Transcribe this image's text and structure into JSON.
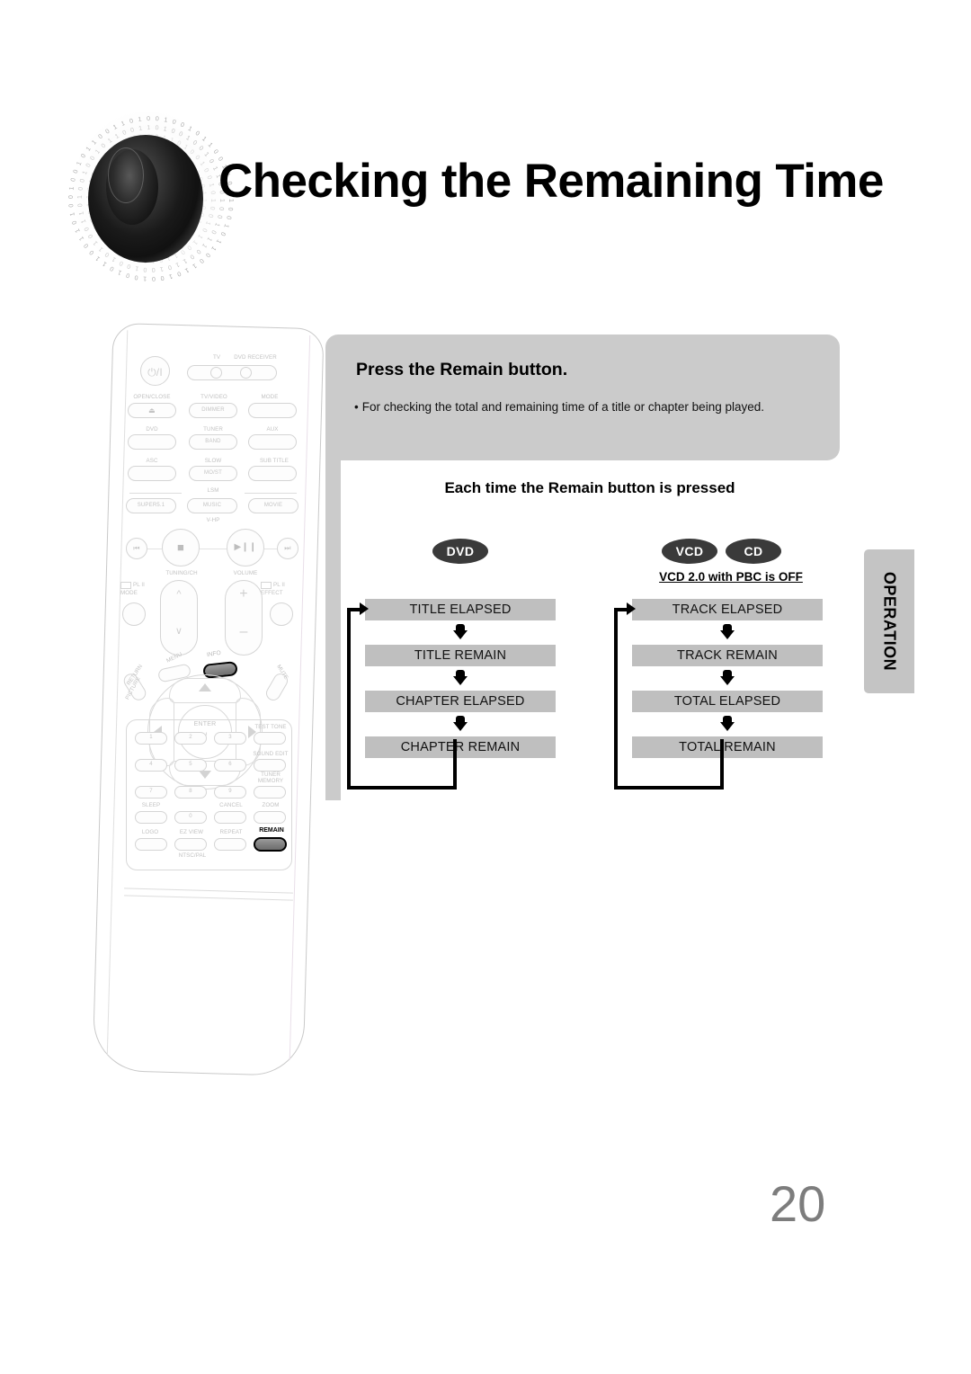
{
  "page": {
    "title": "Checking the Remaining Time",
    "number": "20",
    "side_tab": "OPERATION"
  },
  "callout": {
    "heading": "Press the Remain button.",
    "bullet_marker": "•",
    "bullet_text": "For checking the total and remaining time of a title or chapter being played."
  },
  "flow": {
    "heading": "Each time the Remain button is pressed",
    "note": "VCD 2.0 with PBC is OFF",
    "columns": [
      {
        "badges": [
          "DVD"
        ],
        "steps": [
          "TITLE ELAPSED",
          "TITLE REMAIN",
          "CHAPTER ELAPSED",
          "CHAPTER REMAIN"
        ]
      },
      {
        "badges": [
          "VCD",
          "CD"
        ],
        "steps": [
          "TRACK ELAPSED",
          "TRACK REMAIN",
          "TOTAL ELAPSED",
          "TOTAL REMAIN"
        ]
      }
    ]
  },
  "remote": {
    "power": "⏻/I",
    "selector": {
      "left": "TV",
      "right": "DVD RECEIVER"
    },
    "rows": [
      {
        "labels": [
          "OPEN/CLOSE",
          "TV/VIDEO",
          "MODE"
        ],
        "inner": [
          "⏏",
          "DIMMER",
          ""
        ]
      },
      {
        "labels": [
          "DVD",
          "TUNER",
          "AUX"
        ],
        "inner": [
          "",
          "BAND",
          ""
        ]
      },
      {
        "labels": [
          "ASC",
          "SLOW",
          "SUB TITLE"
        ],
        "inner": [
          "",
          "MO/ST",
          ""
        ]
      }
    ],
    "lsm_label": "LSM",
    "lsm_buttons": [
      "SUPER5.1",
      "MUSIC",
      "MOVIE"
    ],
    "vhp_label": "V-HP",
    "transport": [
      "⏮",
      "■",
      "▶❙❙",
      "⏭"
    ],
    "tuning_label": "TUNING/CH",
    "volume_label": "VOLUME",
    "pl2_mode": "PL II\nMODE",
    "pl2_mode_line1": "PL II",
    "pl2_mode_line2": "MODE",
    "pl2_effect_line1": "PL II",
    "pl2_effect_line2": "EFFECT",
    "menu_label": "MENU",
    "info_label": "INFO",
    "return_label": "RETURN",
    "mute_label": "MUTE",
    "picture_label": "PICTURE",
    "enter_label": "ENTER",
    "keypad": [
      "1",
      "2",
      "3",
      "4",
      "5",
      "6",
      "7",
      "8",
      "9",
      "0"
    ],
    "right_column": [
      "TEST TONE",
      "SOUND EDIT",
      "TUNER MEMORY",
      "ZOOM"
    ],
    "tuner_memory_line1": "TUNER",
    "tuner_memory_line2": "MEMORY",
    "sleep_label": "SLEEP",
    "cancel_label": "CANCEL",
    "logo_label": "LOGO",
    "ezview_label": "EZ VIEW",
    "repeat_label": "REPEAT",
    "remain_label": "REMAIN",
    "ntscpal_label": "NTSC/PAL"
  },
  "colors": {
    "callout_gray": "#cbcbcb",
    "flow_box_gray": "#bfbfbf",
    "badge_dark": "#3a3a3a",
    "tab_gray": "#c4c4c4",
    "page_number_gray": "#7d7d7d"
  }
}
